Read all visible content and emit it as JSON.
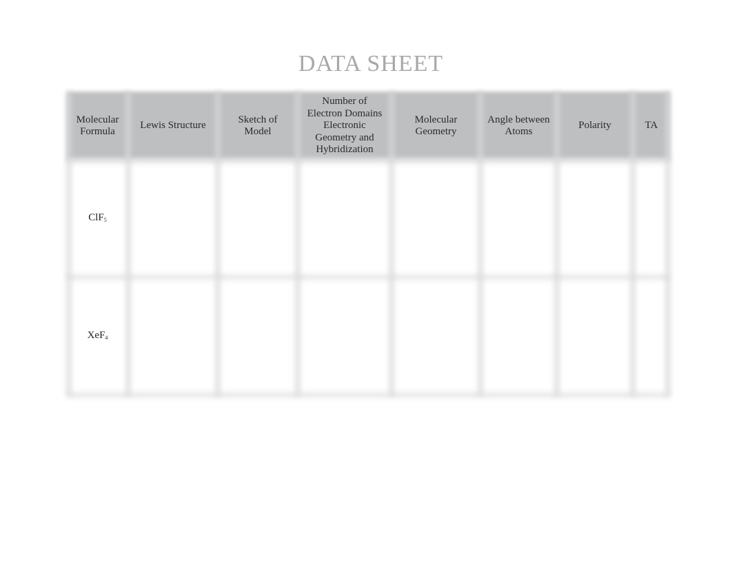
{
  "title": "DATA SHEET",
  "table": {
    "headers": [
      "Molecular Formula",
      "Lewis Structure",
      "Sketch of Model",
      "Number of Electron Domains Electronic Geometry and Hybridization",
      "Molecular Geometry",
      "Angle between Atoms",
      "Polarity",
      "TA"
    ],
    "header_lines": [
      [
        "Molecular",
        "Formula"
      ],
      [
        "Lewis Structure"
      ],
      [
        "Sketch of",
        "Model"
      ],
      [
        "Number of",
        "Electron Domains",
        "Electronic",
        "Geometry and",
        "Hybridization"
      ],
      [
        "Molecular",
        "Geometry"
      ],
      [
        "Angle between",
        "Atoms"
      ],
      [
        "Polarity"
      ],
      [
        "TA"
      ]
    ],
    "rows": [
      {
        "formula_base": "ClF",
        "formula_sub": "5",
        "cells": [
          "",
          "",
          "",
          "",
          "",
          "",
          ""
        ]
      },
      {
        "formula_base": "XeF",
        "formula_sub": "4",
        "cells": [
          "",
          "",
          "",
          "",
          "",
          "",
          ""
        ]
      }
    ]
  },
  "colors": {
    "header_bg": "#bdbfc1",
    "title": "#a8a8ab",
    "grid_line": "#d9d9db"
  }
}
